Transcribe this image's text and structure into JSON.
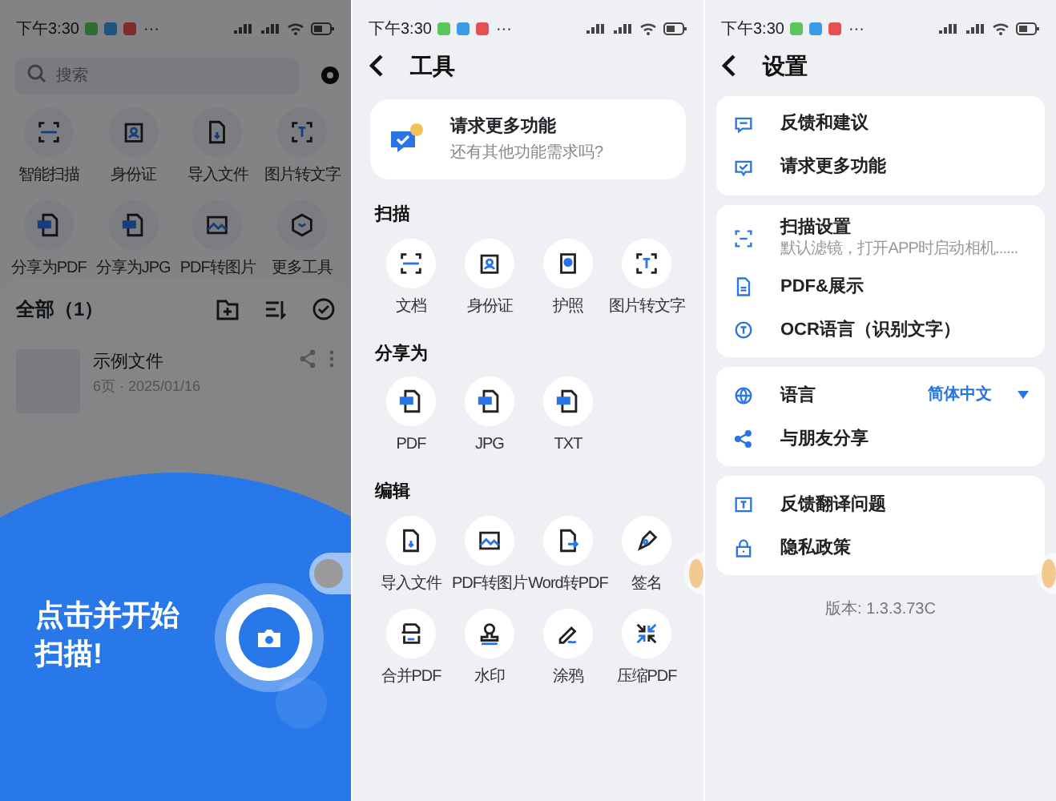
{
  "home": {
    "status_bar": {
      "time": "下午3:30",
      "more": "···"
    },
    "search": {
      "placeholder": "搜索"
    },
    "tools": [
      {
        "label": "智能扫描"
      },
      {
        "label": "身份证"
      },
      {
        "label": "导入文件"
      },
      {
        "label": "图片转文字"
      },
      {
        "label": "分享为PDF"
      },
      {
        "label": "分享为JPG"
      },
      {
        "label": "PDF转图片"
      },
      {
        "label": "更多工具"
      }
    ],
    "files_header": "全部（1）",
    "files": [
      {
        "name": "示例文件",
        "meta": "6页 · 2025/01/16"
      }
    ],
    "scan_prompt": "点击并开始扫描!"
  },
  "tools": {
    "status_bar": {
      "time": "下午3:30",
      "more": "···"
    },
    "title": "工具",
    "request_card": {
      "title": "请求更多功能",
      "subtitle": "还有其他功能需求吗?"
    },
    "sections": [
      {
        "title": "扫描",
        "items": [
          {
            "label": "文档"
          },
          {
            "label": "身份证"
          },
          {
            "label": "护照"
          },
          {
            "label": "图片转文字"
          }
        ]
      },
      {
        "title": "分享为",
        "items": [
          {
            "label": "PDF"
          },
          {
            "label": "JPG"
          },
          {
            "label": "TXT"
          }
        ]
      },
      {
        "title": "编辑",
        "items": [
          {
            "label": "导入文件"
          },
          {
            "label": "PDF转图片"
          },
          {
            "label": "Word转PDF"
          },
          {
            "label": "签名"
          },
          {
            "label": "合并PDF"
          },
          {
            "label": "水印"
          },
          {
            "label": "涂鸦"
          },
          {
            "label": "压缩PDF"
          }
        ]
      }
    ]
  },
  "settings": {
    "status_bar": {
      "time": "下午3:30",
      "more": "···"
    },
    "title": "设置",
    "groups": [
      [
        {
          "label": "反馈和建议"
        },
        {
          "label": "请求更多功能"
        }
      ],
      [
        {
          "label": "扫描设置",
          "subtitle": "默认滤镜，打开APP时启动相机......"
        },
        {
          "label": "PDF&展示"
        },
        {
          "label": "OCR语言（识别文字）"
        }
      ],
      [
        {
          "label": "语言",
          "value": "简体中文"
        },
        {
          "label": "与朋友分享"
        }
      ],
      [
        {
          "label": "反馈翻译问题"
        },
        {
          "label": "隐私政策"
        }
      ]
    ],
    "version": "版本: 1.3.3.73C"
  }
}
